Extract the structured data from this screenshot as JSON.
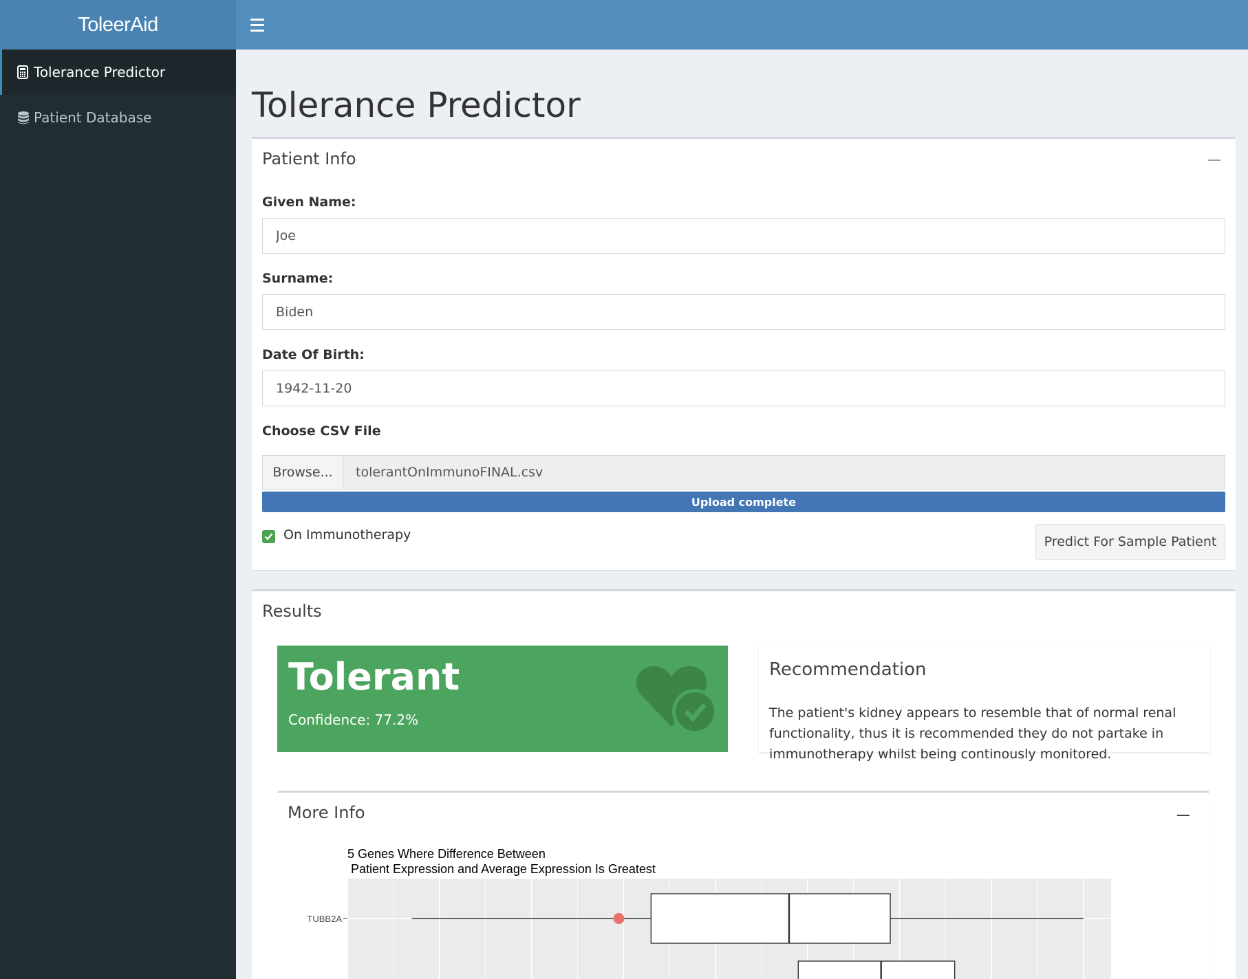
{
  "app": {
    "title": "ToleerAid"
  },
  "sidebar": {
    "items": [
      {
        "label": "Tolerance Predictor",
        "icon": "calculator-icon",
        "active": true
      },
      {
        "label": "Patient Database",
        "icon": "database-icon",
        "active": false
      }
    ]
  },
  "page": {
    "title": "Tolerance Predictor"
  },
  "patient_info": {
    "title": "Patient Info",
    "given_name": {
      "label": "Given Name:",
      "value": "Joe"
    },
    "surname": {
      "label": "Surname:",
      "value": "Biden"
    },
    "dob": {
      "label": "Date Of Birth:",
      "value": "1942-11-20"
    },
    "file": {
      "label": "Choose CSV File",
      "browse_label": "Browse...",
      "file_name": "tolerantOnImmunoFINAL.csv",
      "progress_text": "Upload complete",
      "progress_pct": 100
    },
    "immunotherapy": {
      "label": "On Immunotherapy",
      "checked": true
    },
    "predict_button": "Predict For Sample Patient"
  },
  "results": {
    "title": "Results",
    "status": {
      "value": "Tolerant",
      "confidence": "Confidence: 77.2%",
      "color": "#4ca55e",
      "icon": "heart-check-icon"
    },
    "recommendation": {
      "title": "Recommendation",
      "text": "The patient's kidney appears to resemble that of normal renal functionality, thus it is recommended they do not partake in immunotherapy whilst being continously monitored."
    },
    "more_info": {
      "title": "More Info",
      "chart_title_line1": "5 Genes Where Difference Between",
      "chart_title_line2": "Patient Expression and Average Expression Is Greatest"
    }
  },
  "chart_data": {
    "type": "boxplot",
    "title": "5 Genes Where Difference Between Patient Expression and Average Expression Is Greatest",
    "categories": [
      "TUBB2A"
    ],
    "series": [
      {
        "name": "TUBB2A",
        "whisker_low": 0.7,
        "q1": 3.3,
        "median": 4.8,
        "q3": 5.9,
        "whisker_high": 8.0,
        "patient_value": 2.95
      }
    ],
    "partial_next_box": {
      "q1": 4.9,
      "median": 5.8,
      "q3": 6.6
    },
    "xlim": [
      0,
      8.3
    ],
    "point_color": "#e8736b",
    "grid": true
  }
}
